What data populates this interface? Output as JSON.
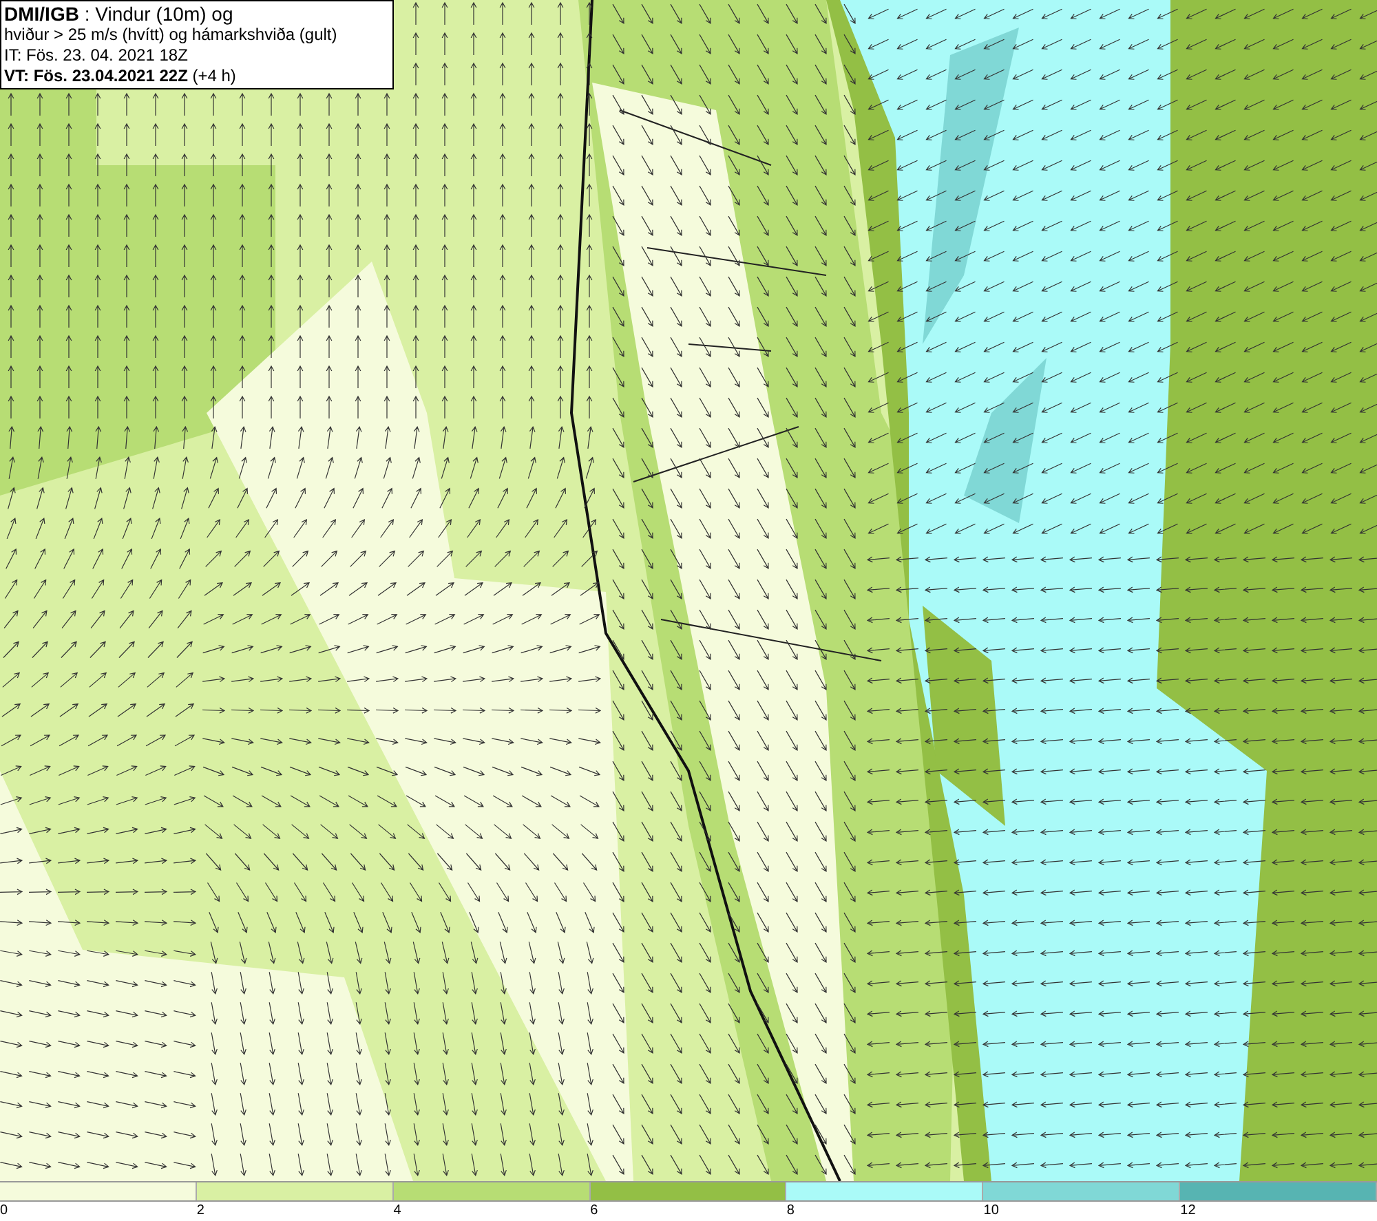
{
  "info_box": {
    "lines": [
      "**DMI/IGB** : Vindur (10m) og",
      "hviður > 25 m/s (hvítt) og hámarkshviða (gult)",
      "IT: Fös. 23. 04. 2021 18Z",
      "**VT: Fös. 23.04.2021 22Z** (+4 h)"
    ]
  },
  "legend": {
    "bins": [
      {
        "label": "0",
        "color": "#f5fbdc"
      },
      {
        "label": "2",
        "color": "#d9f0a3"
      },
      {
        "label": "4",
        "color": "#b7dd74"
      },
      {
        "label": "6",
        "color": "#93bf45"
      },
      {
        "label": "8",
        "color": "#aafaf8"
      },
      {
        "label": "10",
        "color": "#80d8d6"
      },
      {
        "label": "12",
        "color": "#57b4b2"
      }
    ]
  }
}
